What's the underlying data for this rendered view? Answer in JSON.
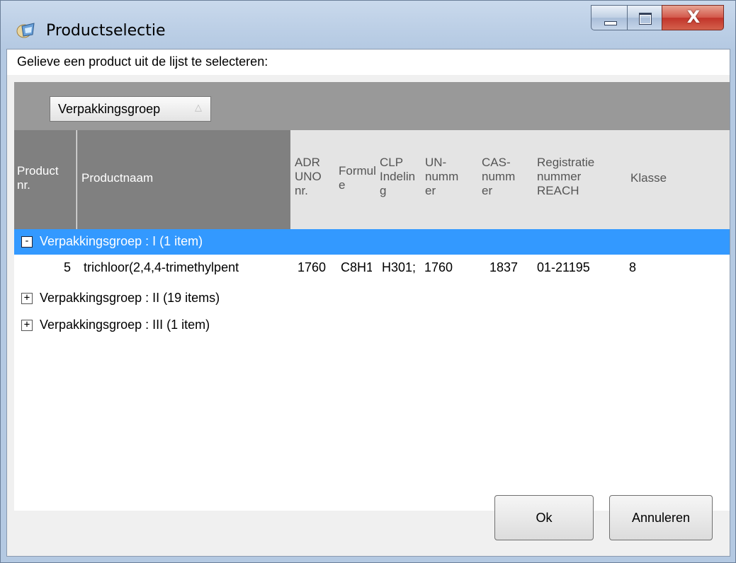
{
  "window": {
    "title": "Productselectie",
    "controls": {
      "minimize": "minimize",
      "maximize": "maximize",
      "close": "X"
    }
  },
  "prompt": "Gelieve een product uit de lijst te selecteren:",
  "grouping": {
    "chip_label": "Verpakkingsgroep",
    "sort_icon": "sort-ascending-icon"
  },
  "columns": [
    {
      "lines": [
        "Product",
        "nr."
      ]
    },
    {
      "lines": [
        "Productnaam"
      ]
    },
    {
      "lines": [
        "ADR",
        "UNO",
        "nr."
      ]
    },
    {
      "lines": [
        "Formul",
        "e"
      ]
    },
    {
      "lines": [
        "CLP",
        "Indelin",
        "g"
      ]
    },
    {
      "lines": [
        "UN-",
        "numm",
        "er"
      ]
    },
    {
      "lines": [
        "CAS-",
        "numm",
        "er"
      ]
    },
    {
      "lines": [
        "Registratie",
        "nummer",
        "REACH"
      ]
    },
    {
      "lines": [
        "Klasse"
      ]
    }
  ],
  "groups": [
    {
      "label": "Verpakkingsgroep : I (1 item)",
      "expander": "-",
      "selected": true,
      "rows": [
        {
          "product_nr": "5",
          "productnaam": "trichloor(2,4,4-trimethylpent",
          "adr_uno_nr": "1760",
          "formule": "C8H1",
          "clp": "H301;",
          "un_nummer": "1760",
          "cas_nummer": "1837",
          "reach": "01-21195",
          "klasse": "8"
        }
      ]
    },
    {
      "label": "Verpakkingsgroep : II (19 items)",
      "expander": "+",
      "selected": false
    },
    {
      "label": "Verpakkingsgroep : III (1 item)",
      "expander": "+",
      "selected": false
    }
  ],
  "buttons": {
    "ok": "Ok",
    "cancel": "Annuleren"
  },
  "colors": {
    "selection": "#3399ff",
    "group_panel": "#999999",
    "header": "#e4e4e4"
  }
}
